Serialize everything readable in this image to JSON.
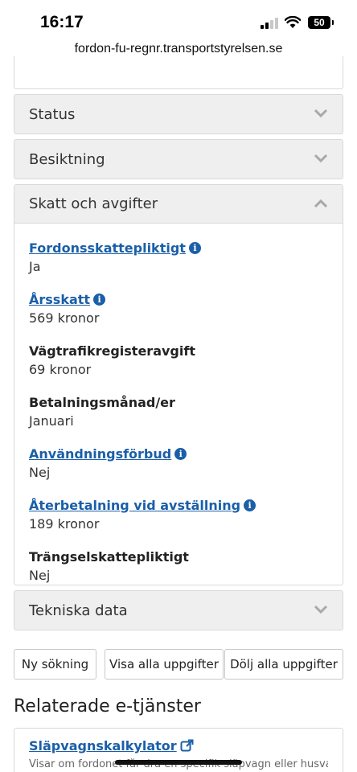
{
  "status_bar": {
    "time": "16:17",
    "battery": "50"
  },
  "browser": {
    "url": "fordon-fu-regnr.transportstyrelsen.se"
  },
  "accordion": {
    "status_label": "Status",
    "besiktning_label": "Besiktning",
    "skatt_label": "Skatt och avgifter",
    "tekniska_label": "Tekniska data"
  },
  "skatt": {
    "fields": [
      {
        "label": "Fordonsskattepliktigt",
        "value": "Ja",
        "link": true,
        "info": true
      },
      {
        "label": "Årsskatt",
        "value": "569 kronor",
        "link": true,
        "info": true
      },
      {
        "label": "Vägtrafikregisteravgift",
        "value": "69 kronor",
        "link": false,
        "info": false
      },
      {
        "label": "Betalningsmånad/er",
        "value": "Januari",
        "link": false,
        "info": false
      },
      {
        "label": "Användningsförbud",
        "value": "Nej",
        "link": true,
        "info": true
      },
      {
        "label": "Återbetalning vid avställning",
        "value": "189 kronor",
        "link": true,
        "info": true
      },
      {
        "label": "Trängselskattepliktigt",
        "value": "Nej",
        "link": false,
        "info": false
      }
    ]
  },
  "buttons": {
    "new_search": "Ny sökning",
    "show_all": "Visa alla uppgifter",
    "hide_all": "Dölj alla uppgifter"
  },
  "related": {
    "title": "Relaterade e-tjänster",
    "service_link": "Släpvagnskalkylator",
    "service_desc": "Visar om fordonet får dra en specifik släpvagn eller husvagn."
  },
  "icons": {
    "info": "info-icon",
    "chevron_down": "chevron-down-icon",
    "chevron_up": "chevron-up-icon",
    "external": "external-link-icon"
  },
  "colors": {
    "link": "#1a5fa8",
    "panel_bg": "#efefef",
    "border": "#d9d9d9"
  }
}
